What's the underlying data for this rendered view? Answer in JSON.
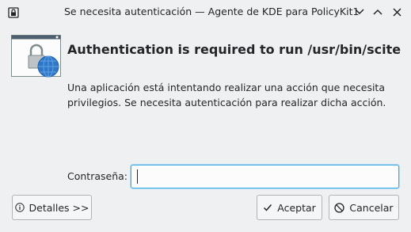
{
  "window": {
    "title": "Se necesita autenticación — Agente de KDE para PolicyKit1"
  },
  "dialog": {
    "heading": "Authentication is required to run /usr/bin/scite",
    "message": "Una aplicación está intentando realizar una acción que necesita privilegios. Se necesita autenticación para realizar dicha acción.",
    "password_label": "Contraseña:",
    "password_value": ""
  },
  "buttons": {
    "details": "Detalles >>",
    "accept": "Aceptar",
    "cancel": "Cancelar"
  },
  "colors": {
    "accent": "#3daee9",
    "background": "#eff0f1"
  },
  "icons": {
    "window": "lock-icon",
    "header": "authentication-lock-globe-icon",
    "details": "info-icon",
    "accept": "check-icon",
    "cancel": "cancel-icon"
  }
}
